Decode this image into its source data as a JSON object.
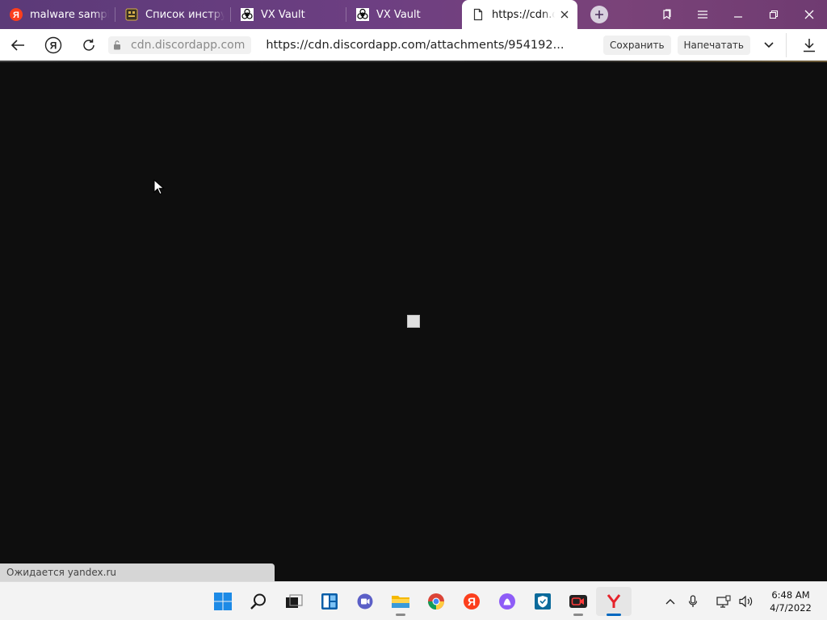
{
  "tabs": [
    {
      "title": "malware samples",
      "icon": "yandex-icon"
    },
    {
      "title": "Список инструм",
      "icon": "site-favicon"
    },
    {
      "title": "VX Vault",
      "icon": "biohazard-icon"
    },
    {
      "title": "VX Vault",
      "icon": "biohazard-icon"
    },
    {
      "title": "https://cdn.disc",
      "icon": "document-icon",
      "active": true
    }
  ],
  "toolbar": {
    "domain": "cdn.discordapp.com",
    "url": "https://cdn.discordapp.com/attachments/954192...",
    "save_label": "Сохранить",
    "print_label": "Напечатать"
  },
  "status": {
    "text": "Ожидается yandex.ru"
  },
  "taskbar": {
    "apps": [
      "windows-start",
      "search",
      "task-view",
      "widgets",
      "teams-chat",
      "file-explorer",
      "chrome",
      "yandex",
      "alice",
      "defender",
      "screen-recorder",
      "yandex-browser"
    ],
    "time": "6:48 AM",
    "date": "4/7/2022"
  },
  "colors": {
    "tabstrip": "#6d3f82",
    "content_bg": "#0e0e0e",
    "accent_blue": "#0067c0"
  }
}
